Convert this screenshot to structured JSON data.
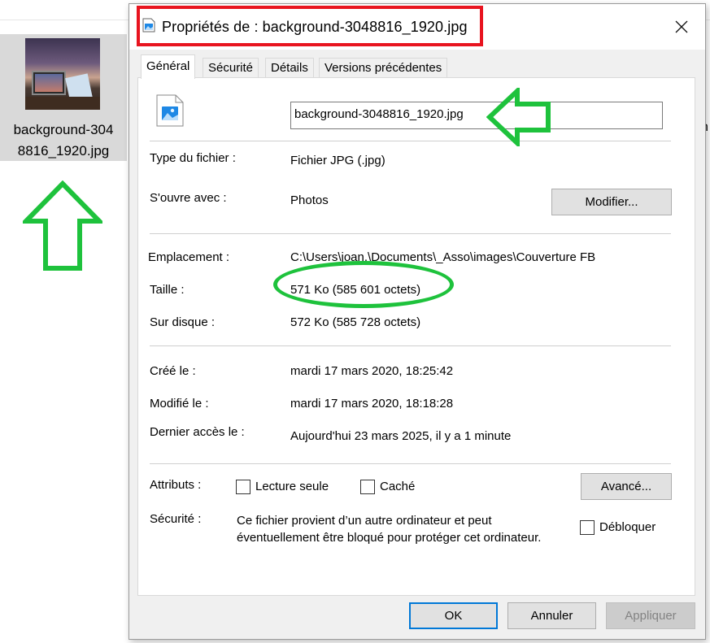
{
  "explorer": {
    "file_name_line1": "background-304",
    "file_name_line2": "8816_1920.jpg",
    "edge_letter": "h"
  },
  "dialog": {
    "title": "Propriétés de : background-3048816_1920.jpg",
    "tabs": [
      {
        "label": "Général",
        "active": true
      },
      {
        "label": "Sécurité",
        "active": false
      },
      {
        "label": "Détails",
        "active": false
      },
      {
        "label": "Versions précédentes",
        "active": false
      }
    ],
    "filename_value": "background-3048816_1920.jpg",
    "type": {
      "label": "Type du fichier :",
      "value": "Fichier JPG (.jpg)"
    },
    "opens_with": {
      "label": "S'ouvre avec :",
      "value": "Photos",
      "button": "Modifier..."
    },
    "location": {
      "label": "Emplacement :",
      "value": "C:\\Users\\joan.\\Documents\\_Asso\\images\\Couverture FB"
    },
    "size": {
      "label": "Taille :",
      "value": "571 Ko (585 601 octets)"
    },
    "size_on_disk": {
      "label": "Sur disque :",
      "value": "572 Ko (585 728 octets)"
    },
    "created": {
      "label": "Créé le :",
      "value": "mardi 17 mars 2020, 18:25:42"
    },
    "modified": {
      "label": "Modifié le :",
      "value": "mardi 17 mars 2020, 18:18:28"
    },
    "accessed": {
      "label": "Dernier accès le :",
      "value": "Aujourd'hui 23 mars 2025, il y a 1 minute"
    },
    "attributes": {
      "label": "Attributs :",
      "readonly_label": "Lecture seule",
      "readonly_checked": false,
      "hidden_label": "Caché",
      "hidden_checked": false,
      "advanced_button": "Avancé..."
    },
    "security": {
      "label": "Sécurité :",
      "line1": "Ce fichier provient d’un autre ordinateur et peut",
      "line2": "éventuellement être bloqué pour protéger cet ordinateur.",
      "unblock_label": "Débloquer",
      "unblock_checked": false
    },
    "buttons": {
      "ok": "OK",
      "cancel": "Annuler",
      "apply": "Appliquer"
    }
  },
  "colors": {
    "highlight_red": "#e8141f",
    "annotation_green": "#1ec23c",
    "focus_blue": "#0078d7"
  }
}
